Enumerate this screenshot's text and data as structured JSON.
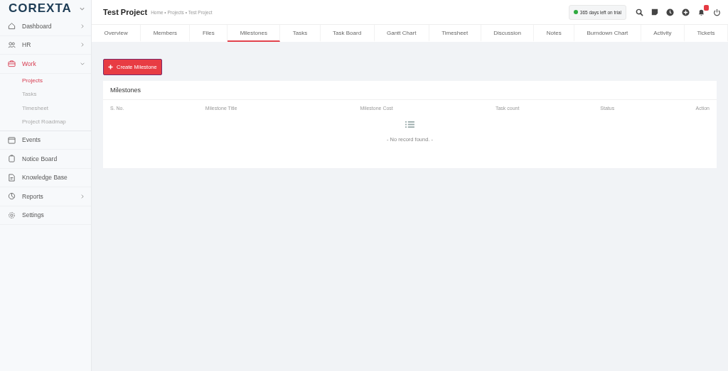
{
  "logo": "COREXTA",
  "sidebar": {
    "items": [
      {
        "label": "Dashboard",
        "expanded": false,
        "selected": false
      },
      {
        "label": "HR",
        "expanded": false,
        "selected": false
      },
      {
        "label": "Work",
        "expanded": true,
        "selected": true,
        "children": [
          {
            "label": "Projects",
            "selected": true
          },
          {
            "label": "Tasks",
            "selected": false
          },
          {
            "label": "Timesheet",
            "selected": false
          },
          {
            "label": "Project Roadmap",
            "selected": false
          }
        ]
      },
      {
        "label": "Events",
        "selected": false
      },
      {
        "label": "Notice Board",
        "selected": false
      },
      {
        "label": "Knowledge Base",
        "selected": false
      },
      {
        "label": "Reports",
        "expanded": false,
        "selected": false
      },
      {
        "label": "Settings",
        "selected": false
      }
    ]
  },
  "header": {
    "title": "Test Project",
    "breadcrumb": "Home • Projects • Test Project",
    "trial": "365 days left on trial",
    "notifications": true
  },
  "tabs": [
    {
      "label": "Overview",
      "selected": false
    },
    {
      "label": "Members",
      "selected": false
    },
    {
      "label": "Files",
      "selected": false
    },
    {
      "label": "Milestones",
      "selected": true
    },
    {
      "label": "Tasks",
      "selected": false
    },
    {
      "label": "Task Board",
      "selected": false
    },
    {
      "label": "Gantt Chart",
      "selected": false
    },
    {
      "label": "Timesheet",
      "selected": false
    },
    {
      "label": "Discussion",
      "selected": false
    },
    {
      "label": "Notes",
      "selected": false
    },
    {
      "label": "Burndown Chart",
      "selected": false
    },
    {
      "label": "Activity",
      "selected": false
    },
    {
      "label": "Tickets",
      "selected": false
    }
  ],
  "create_button": "Create Milestone",
  "card": {
    "title": "Milestones",
    "columns": [
      "S. No.",
      "Milestone Title",
      "Milestone Cost",
      "Task count",
      "Status",
      "Action"
    ],
    "empty": "- No record found. -"
  }
}
